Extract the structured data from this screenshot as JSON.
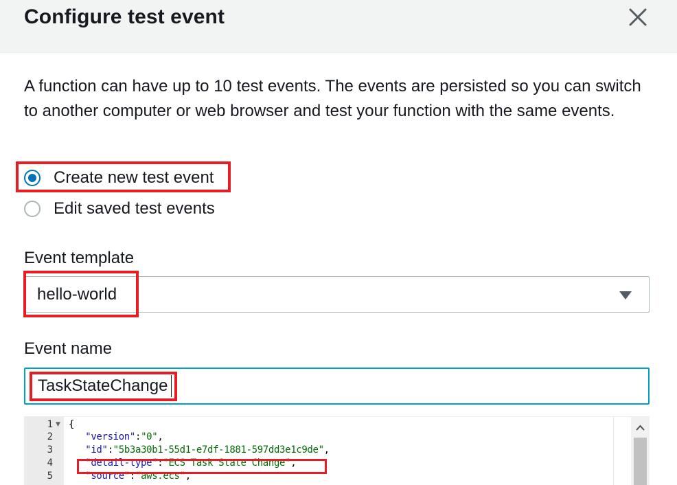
{
  "dialog": {
    "title": "Configure test event",
    "close_icon": "close-icon"
  },
  "description": "A function can have up to 10 test events. The events are persisted so you can switch to another computer or web browser and test your function with the same events.",
  "options": [
    {
      "label": "Create new test event",
      "checked": true
    },
    {
      "label": "Edit saved test events",
      "checked": false
    }
  ],
  "event_template": {
    "label": "Event template",
    "value": "hello-world"
  },
  "event_name": {
    "label": "Event name",
    "value": "TaskStateChange"
  },
  "editor": {
    "lines": [
      {
        "num": "1",
        "fold": true
      },
      {
        "num": "2",
        "key": "\"version\"",
        "value": "\"0\""
      },
      {
        "num": "3",
        "key": "\"id\"",
        "value": "\"5b3a30b1-55d1-e7df-1881-597dd3e1c9de\""
      },
      {
        "num": "4",
        "key": "\"detail-type\"",
        "value": "\"ECS Task State Change\""
      },
      {
        "num": "5",
        "key": "\"source\"",
        "value": "\"aws.ecs\""
      }
    ],
    "open_brace": "{"
  },
  "colors": {
    "accent": "#0073bb",
    "focus_border": "#00a1c9",
    "annotation": "#e31e25"
  }
}
